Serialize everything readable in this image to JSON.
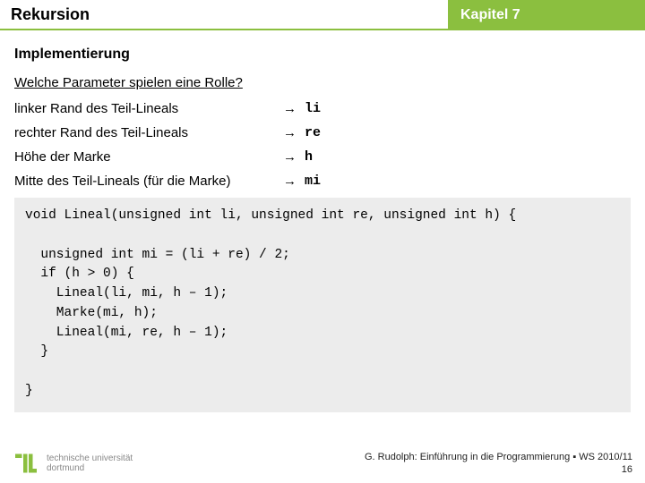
{
  "header": {
    "title_left": "Rekursion",
    "title_right": "Kapitel 7"
  },
  "body": {
    "section_title": "Implementierung",
    "question": "Welche Parameter spielen eine Rolle?",
    "params": [
      {
        "label": "linker Rand des Teil-Lineals",
        "arrow": "→",
        "var": "li"
      },
      {
        "label": "rechter Rand des Teil-Lineals",
        "arrow": "→",
        "var": "re"
      },
      {
        "label": "Höhe der Marke",
        "arrow": "→",
        "var": "h"
      },
      {
        "label": "Mitte des Teil-Lineals (für die Marke)",
        "arrow": "→",
        "var": "mi"
      }
    ],
    "code": "void Lineal(unsigned int li, unsigned int re, unsigned int h) {\n\n  unsigned int mi = (li + re) / 2;\n  if (h > 0) {\n    Lineal(li, mi, h – 1);\n    Marke(mi, h);\n    Lineal(mi, re, h – 1);\n  }\n\n}"
  },
  "footer": {
    "institution_line1": "technische universität",
    "institution_line2": "dortmund",
    "attribution": "G. Rudolph: Einführung in die Programmierung ▪ WS 2010/11",
    "page_number": "16"
  },
  "colors": {
    "accent": "#8bbf3f",
    "code_bg": "#ececec",
    "muted": "#888"
  }
}
